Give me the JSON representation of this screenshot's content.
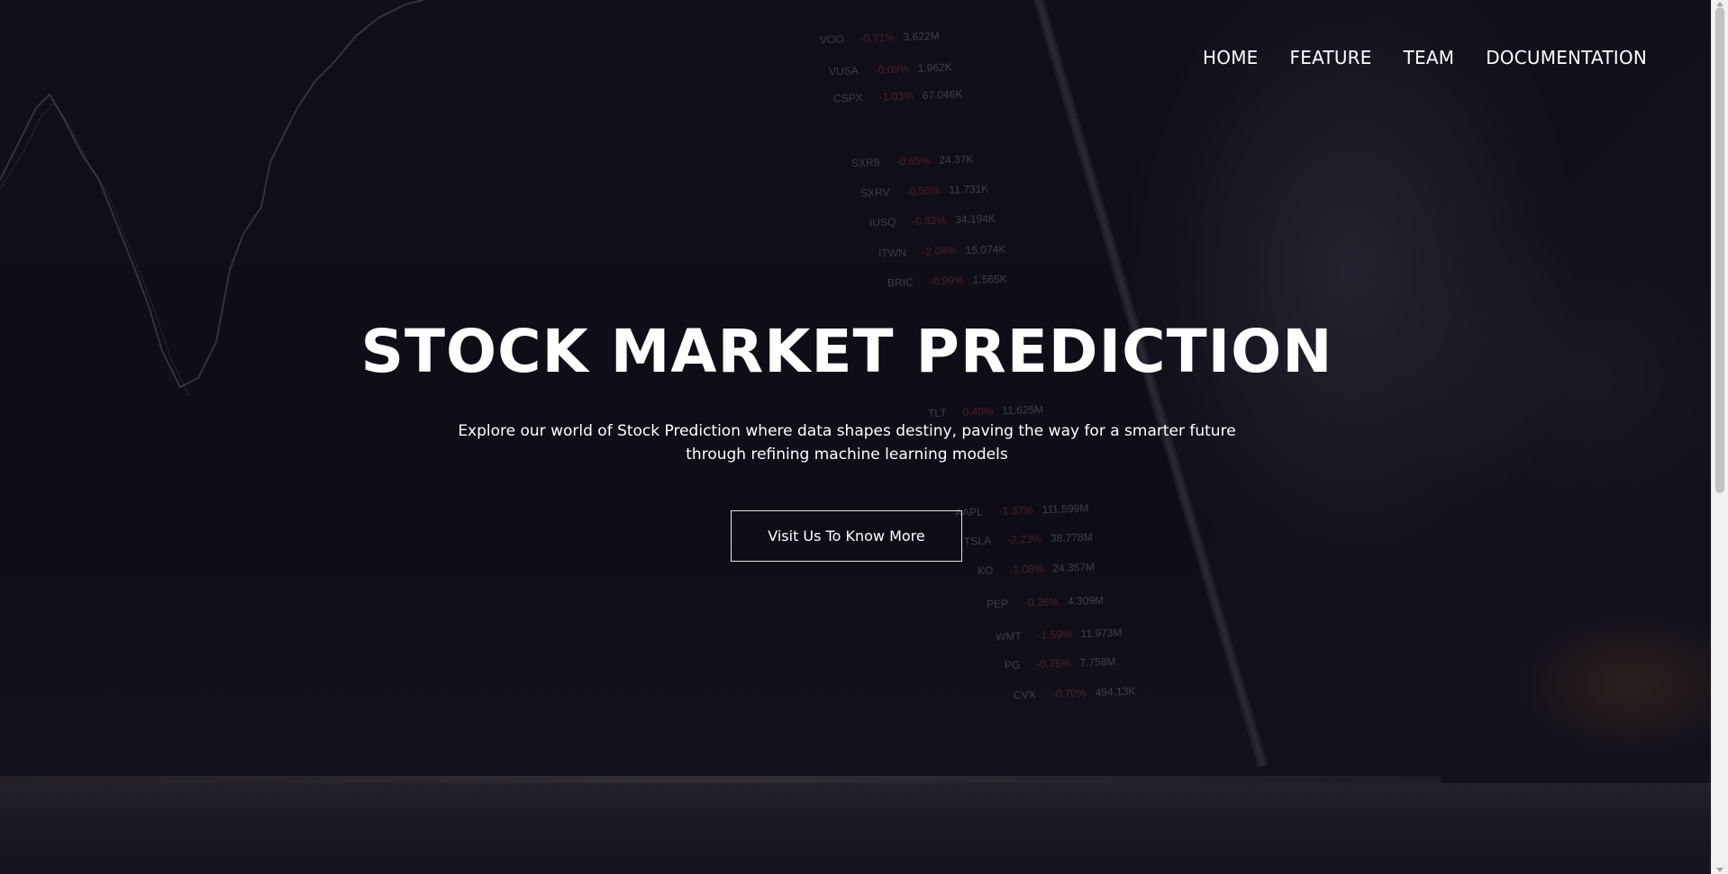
{
  "nav": {
    "items": [
      {
        "label": "HOME"
      },
      {
        "label": "FEATURE"
      },
      {
        "label": "TEAM"
      },
      {
        "label": "DOCUMENTATION"
      }
    ]
  },
  "hero": {
    "title": "STOCK MARKET PREDICTION",
    "subtitle_line1": "Explore our world of Stock Prediction where data shapes destiny, paving the way for a smarter future",
    "subtitle_line2": "through refining machine learning models",
    "cta_label": "Visit Us To Know More"
  },
  "background_tickers": [
    {
      "symbol": "VOO",
      "change": "-0.71%",
      "volume": "3.622M"
    },
    {
      "symbol": "VUSA",
      "change": "-0.09%",
      "volume": "1.962K"
    },
    {
      "symbol": "CSPX",
      "change": "-1.03%",
      "volume": "67.046K"
    },
    {
      "symbol": "SXR8",
      "change": "-0.65%",
      "volume": "24.37K"
    },
    {
      "symbol": "SXRV",
      "change": "-0.56%",
      "volume": "11.731K"
    },
    {
      "symbol": "IUSQ",
      "change": "-0.82%",
      "volume": "34.194K"
    },
    {
      "symbol": "ITWN",
      "change": "-2.06%",
      "volume": "15.074K"
    },
    {
      "symbol": "BRIC",
      "change": "-0.99%",
      "volume": "1.565K"
    },
    {
      "symbol": "TLT",
      "change": "0.40%",
      "volume": "11.625M"
    },
    {
      "symbol": "AAPL",
      "change": "-1.37%",
      "volume": "111.599M"
    },
    {
      "symbol": "TSLA",
      "change": "-2.23%",
      "volume": "38.778M"
    },
    {
      "symbol": "KO",
      "change": "-1.08%",
      "volume": "24.367M"
    },
    {
      "symbol": "PEP",
      "change": "-0.26%",
      "volume": "4.309M"
    },
    {
      "symbol": "WMT",
      "change": "-1.59%",
      "volume": "11.973M"
    },
    {
      "symbol": "PG",
      "change": "-0.75%",
      "volume": "7.758M"
    },
    {
      "symbol": "CVX",
      "change": "-0.70%",
      "volume": "494.13K"
    }
  ],
  "colors": {
    "overlay": "#16121d",
    "text": "#ffffff",
    "button_border": "#e6e6e6"
  }
}
